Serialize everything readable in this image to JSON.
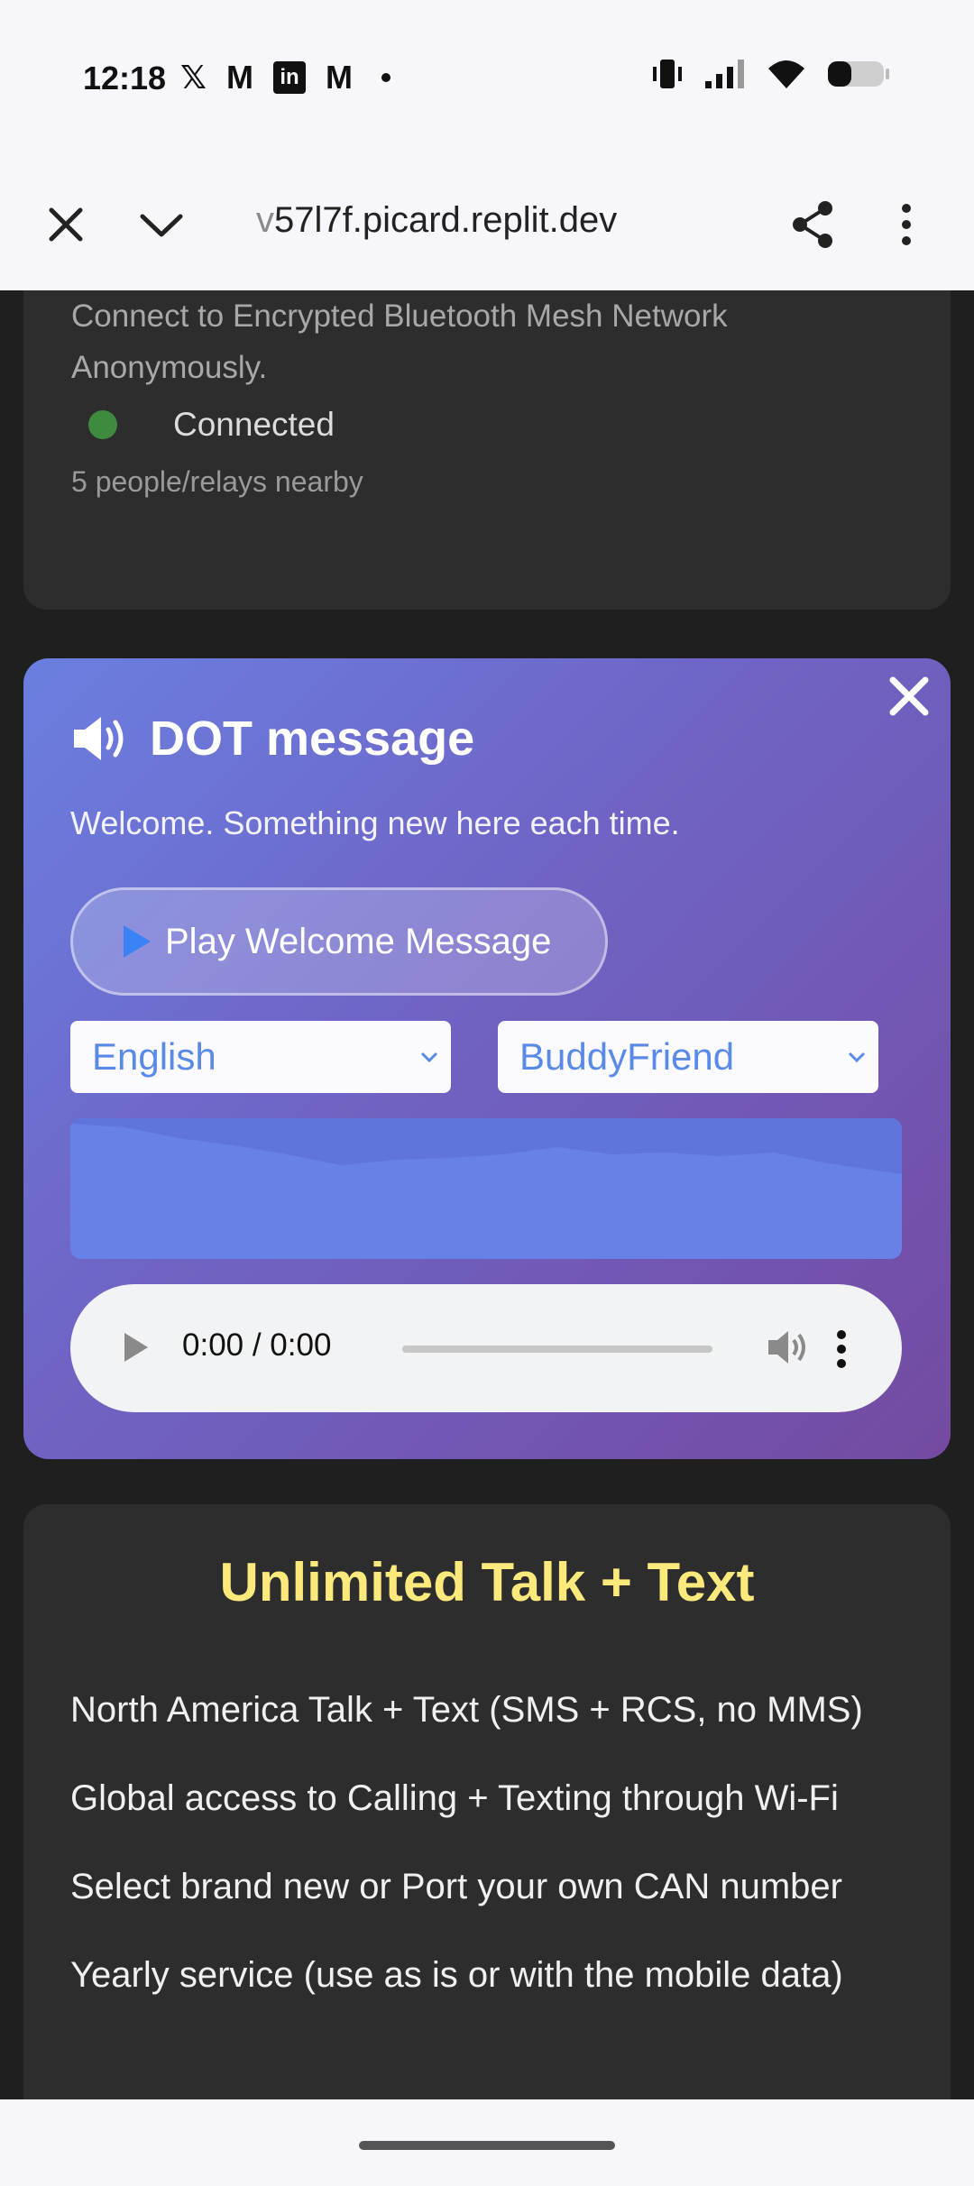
{
  "status_bar": {
    "time": "12:18",
    "notif_icons": [
      "x-icon",
      "gmail-icon",
      "linkedin-icon",
      "gmail-icon"
    ],
    "x_glyph": "𝕏",
    "gmail_glyph": "M",
    "linkedin_glyph": "in"
  },
  "url_bar": {
    "url_fade": "v",
    "url": "57l7f.picard.replit.dev"
  },
  "bluetooth_card": {
    "description": "Connect to Encrypted Bluetooth Mesh Network Anonymously.",
    "status": "Connected",
    "status_color": "#3f8a3f",
    "nearby": "5 people/relays nearby"
  },
  "message_card": {
    "title": "DOT message",
    "subtitle": "Welcome. Something new here each time.",
    "play_button": "Play Welcome Message",
    "language_select": "English",
    "voice_select": "BuddyFriend",
    "audio_time": "0:00 / 0:00"
  },
  "plan_card": {
    "title": "Unlimited Talk + Text",
    "title_color": "#fbe97c",
    "items": [
      "North America Talk + Text (SMS + RCS, no MMS)",
      "Global access to Calling + Texting through Wi-Fi",
      "Select brand new or Port your own CAN number",
      "Yearly service (use as is or with the mobile data)"
    ]
  }
}
